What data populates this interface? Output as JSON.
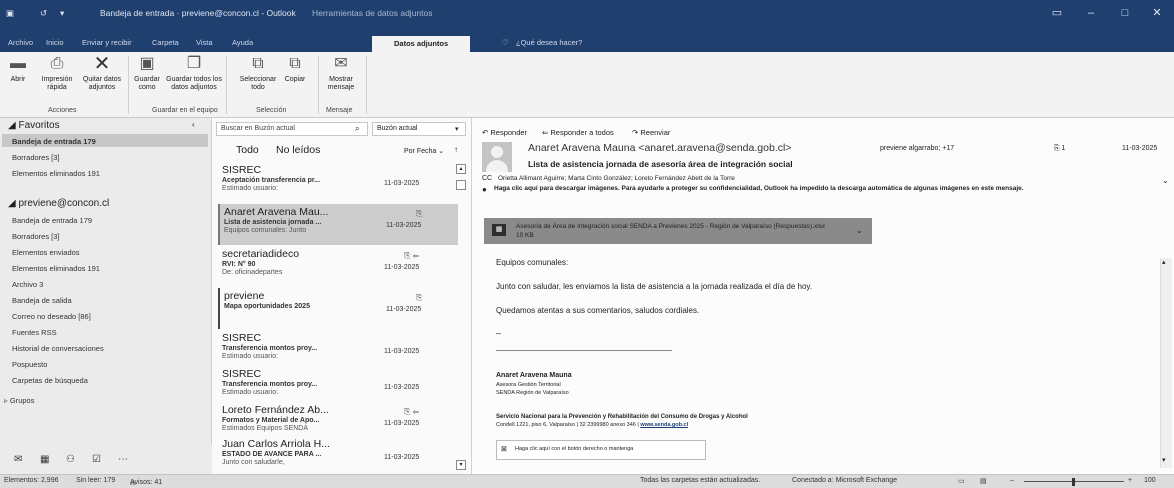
{
  "window": {
    "title": "Bandeja de entrada · previene@concon.cl - Outlook",
    "context_tab": "Herramientas de datos adjuntos"
  },
  "menu_tabs": [
    "Archivo",
    "Inicio",
    "Enviar y recibir",
    "Carpeta",
    "Vista",
    "Ayuda",
    "Datos adjuntos"
  ],
  "tell_me": "¿Qué desea hacer?",
  "ribbon": {
    "abrir": "Abrir",
    "impresion": "Impresión rápida",
    "quitar": "Quitar datos adjuntos",
    "grupo_acciones": "Acciones",
    "guardar_como": "Guardar como",
    "guardar_todos": "Guardar todos los datos adjuntos",
    "grupo_guardar": "Guardar en el equipo",
    "seleccionar_todo": "Seleccionar todo",
    "copiar": "Copiar",
    "grupo_seleccion": "Selección",
    "mostrar_mensaje": "Mostrar mensaje",
    "grupo_mensaje": "Mensaje"
  },
  "folders": {
    "favoritos": "Favoritos",
    "fav_items": [
      "Bandeja de entrada 179",
      "Borradores [3]",
      "Elementos eliminados 191"
    ],
    "account": "previene@concon.cl",
    "account_items": [
      "Bandeja de entrada 179",
      "Borradores [3]",
      "Elementos enviados",
      "Elementos eliminados 191",
      "Archivo 3",
      "Bandeja de salida",
      "Correo no deseado [86]",
      "Fuentes RSS",
      "Historial de conversaciones",
      "Pospuesto",
      "Carpetas de búsqueda"
    ],
    "grupos": "Grupos"
  },
  "list": {
    "search_placeholder": "Buscar en Buzón actual",
    "scope": "Buzón actual",
    "tab_all": "Todo",
    "tab_unread": "No leídos",
    "sort": "Por Fecha",
    "messages": [
      {
        "from": "SISREC",
        "subject": "Aceptación transferencia pr...",
        "preview": "Estimado usuario:",
        "date": "11-03-2025"
      },
      {
        "from": "Anaret Aravena Mau...",
        "subject": "Lista de asistencia jornada ...",
        "preview": "Equipos comunales: Junto",
        "date": "11-03-2025"
      },
      {
        "from": "secretariadideco",
        "subject": "RVI: N° 90",
        "preview": "De: oficinadepartes",
        "date": "11-03-2025"
      },
      {
        "from": "previene",
        "subject": "Mapa oportunidades 2025",
        "preview": "",
        "date": "11-03-2025"
      },
      {
        "from": "SISREC",
        "subject": "Transferencia montos proy...",
        "preview": "Estimado usuario:",
        "date": "11-03-2025"
      },
      {
        "from": "SISREC",
        "subject": "Transferencia montos proy...",
        "preview": "Estimado usuario:",
        "date": "11-03-2025"
      },
      {
        "from": "Loreto Fernández Ab...",
        "subject": "Formatos y Material de Apo...",
        "preview": "Estimados Equipos SENDA",
        "date": "11-03-2025"
      },
      {
        "from": "Juan Carlos Arriola H...",
        "subject": "ESTADO DE AVANCE PARA ...",
        "preview": "Junto con saludarle,",
        "date": "11-03-2025"
      }
    ]
  },
  "reading": {
    "reply": "Responder",
    "reply_all": "Responder a todos",
    "forward": "Reenviar",
    "sender": "Anaret Aravena Mauna <anaret.aravena@senda.gob.cl>",
    "to_label": "previene algarrabo; +17",
    "att_count": "1",
    "date": "11-03-2025",
    "subject": "Lista de asistencia jornada de asesoría área de integración social",
    "cc_label": "CC",
    "cc": "Orietta Allimant Aguirre; Marta Cinto González; Loreto Fernández Abett de la Torre",
    "info": "Haga clic aquí para descargar imágenes. Para ayudarle a proteger su confidencialidad, Outlook ha impedido la descarga automática de algunas imágenes en este mensaje.",
    "attachment_name": "Asesoría de Área de Integración social SENDA a Previenes 2025 - Región de Valparaíso (Respuestas).xlsx",
    "attachment_size": "10 KB",
    "greeting": "Equipos comunales:",
    "body1": "Junto con saludar, les enviamos la lista de asistencia a la jornada realizada el día de hoy.",
    "body2": "Quedamos atentas a sus comentarios, saludos cordiales.",
    "dash": "–",
    "sig_name": "Anaret Aravena Mauna",
    "sig_role": "Asesora Gestión Territorial",
    "sig_region": "SENDA Región de Valparaíso",
    "sig_org": "Servicio Nacional para la Prevención y Rehabilitación del Consumo de Drogas y Alcohol",
    "sig_addr": "Condell 1221, piso 6, Valparaíso | 32 2399980 anexo 346 |",
    "sig_web": "www.senda.gob.cl",
    "img_placeholder": "Haga clic aquí con el botón derecho o mantenga"
  },
  "status": {
    "elements": "Elementos: 2,996",
    "unread": "Sin leer: 179",
    "alerts": "Avisos: 41",
    "sync": "Todas las carpetas están actualizadas.",
    "connected": "Conectado a: Microsoft Exchange",
    "zoom": "100"
  },
  "colors": {
    "titlebar": "#1f3f6e",
    "accent": "#2b579a",
    "selection": "#c8c8c8",
    "attachment_bar": "#8a8a8a"
  }
}
